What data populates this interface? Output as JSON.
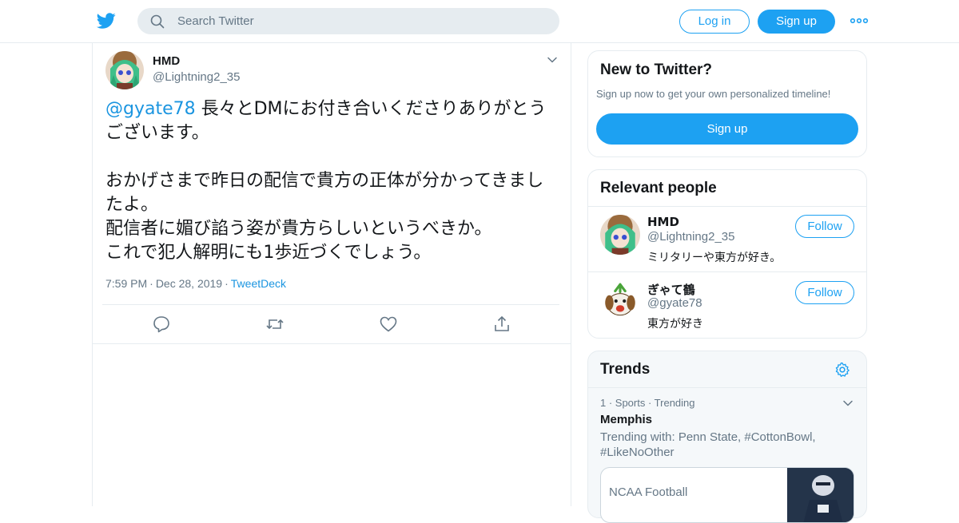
{
  "header": {
    "search_placeholder": "Search Twitter",
    "login_label": "Log in",
    "signup_label": "Sign up",
    "brand_color": "#1da1f2"
  },
  "tweet": {
    "name": "HMD",
    "handle": "@Lightning2_35",
    "mention": "@gyate78",
    "text_line1": " 長々とDMにお付き合いくださりありがとうございます。",
    "text_para2": "おかげさまで昨日の配信で貴方の正体が分かってきましたよ。",
    "text_para3": "配信者に媚び諂う姿が貴方らしいというべきか。",
    "text_para4": "これで犯人解明にも1歩近づくでしょう。",
    "time": "7:59 PM",
    "sep": "·",
    "date": "Dec 28, 2019",
    "source": "TweetDeck"
  },
  "sidebar": {
    "new_to_twitter": {
      "title": "New to Twitter?",
      "subtitle": "Sign up now to get your own personalized timeline!",
      "signup_label": "Sign up"
    },
    "relevant_people": {
      "title": "Relevant people",
      "people": [
        {
          "name": "HMD",
          "handle": "@Lightning2_35",
          "bio": "ミリタリーや東方が好き。",
          "follow_label": "Follow"
        },
        {
          "name": "ぎゃて鶴",
          "handle": "@gyate78",
          "bio": "東方が好き",
          "follow_label": "Follow"
        }
      ]
    },
    "trends": {
      "title": "Trends",
      "items": [
        {
          "meta": "1 · Sports · Trending",
          "name": "Memphis",
          "with": "Trending with: Penn State, #CottonBowl, #LikeNoOther",
          "news_source": "NCAA Football"
        }
      ]
    }
  }
}
